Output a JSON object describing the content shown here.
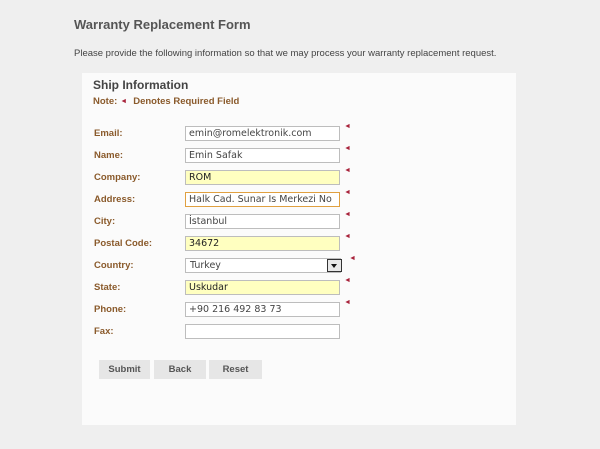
{
  "page": {
    "title": "Warranty Replacement Form",
    "intro": "Please provide the following information so that we may process your warranty replacement request."
  },
  "section": {
    "title": "Ship Information",
    "note_label": "Note:",
    "note_text": "Denotes Required Field",
    "required_marker": "◄"
  },
  "fields": {
    "email": {
      "label": "Email:",
      "value": "emin@romelektronik.com"
    },
    "name": {
      "label": "Name:",
      "value": "Emin Safak"
    },
    "company": {
      "label": "Company:",
      "value": "ROM"
    },
    "address": {
      "label": "Address:",
      "value": "Halk Cad. Sunar Is Merkezi No"
    },
    "city": {
      "label": "City:",
      "value": "İstanbul"
    },
    "postal_code": {
      "label": "Postal Code:",
      "value": "34672"
    },
    "country": {
      "label": "Country:",
      "value": "Turkey"
    },
    "state": {
      "label": "State:",
      "value": "Uskudar"
    },
    "phone": {
      "label": "Phone:",
      "value": "+90 216 492 83 73"
    },
    "fax": {
      "label": "Fax:",
      "value": ""
    }
  },
  "buttons": {
    "submit": "Submit",
    "back": "Back",
    "reset": "Reset"
  },
  "colors": {
    "label": "#8a5a2b",
    "required_marker": "#a8233b",
    "autofill_background": "#ffffc0"
  }
}
